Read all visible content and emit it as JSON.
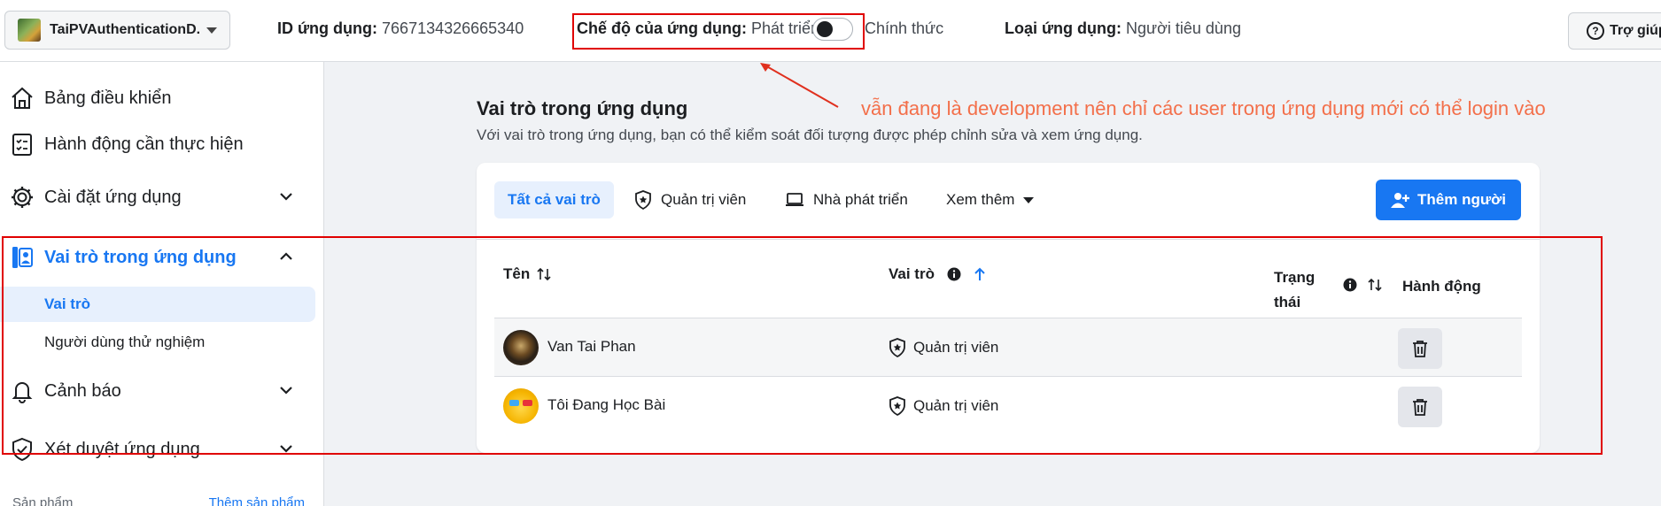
{
  "header": {
    "app_name": "TaiPVAuthenticationD...",
    "app_id_label": "ID ứng dụng:",
    "app_id_value": "7667134326665340",
    "mode_label": "Chế độ của ứng dụng:",
    "mode_dev": "Phát triển",
    "mode_live": "Chính thức",
    "app_type_label": "Loại ứng dụng:",
    "app_type_value": "Người tiêu dùng",
    "help_label": "Trợ giúp"
  },
  "sidebar": {
    "items": [
      {
        "label": "Bảng điều khiển",
        "icon": "home-icon"
      },
      {
        "label": "Hành động cần thực hiện",
        "icon": "checklist-icon"
      },
      {
        "label": "Cài đặt ứng dụng",
        "icon": "gear-icon"
      },
      {
        "label": "Vai trò trong ứng dụng",
        "icon": "roles-icon"
      },
      {
        "label": "Cảnh báo",
        "icon": "bell-icon"
      },
      {
        "label": "Xét duyệt ứng dụng",
        "icon": "shield-check-icon"
      }
    ],
    "sub_items": [
      {
        "label": "Vai trò"
      },
      {
        "label": "Người dùng thử nghiệm"
      }
    ],
    "footer_label": "Sản phẩm",
    "footer_link": "Thêm sản phẩm"
  },
  "main": {
    "title": "Vai trò trong ứng dụng",
    "description": "Với vai trò trong ứng dụng, bạn có thể kiểm soát đối tượng được phép chỉnh sửa và xem ứng dụng.",
    "annotation": "vẫn đang là development nên chỉ các user trong ứng dụng mới có thể login vào",
    "tabs": [
      {
        "label": "Tất cả vai trò"
      },
      {
        "label": "Quản trị viên"
      },
      {
        "label": "Nhà phát triển"
      },
      {
        "label": "Xem thêm"
      }
    ],
    "add_button": "Thêm người",
    "table": {
      "headers": [
        "Tên",
        "Vai trò",
        "Trạng thái",
        "Hành động"
      ],
      "rows": [
        {
          "name": "Van Tai Phan",
          "role": "Quản trị viên"
        },
        {
          "name": "Tôi Đang Học Bài",
          "role": "Quản trị viên"
        }
      ]
    }
  },
  "colors": {
    "accent": "#1877f2",
    "highlight_border": "#e00000",
    "annotation_text": "#f36f4a"
  }
}
